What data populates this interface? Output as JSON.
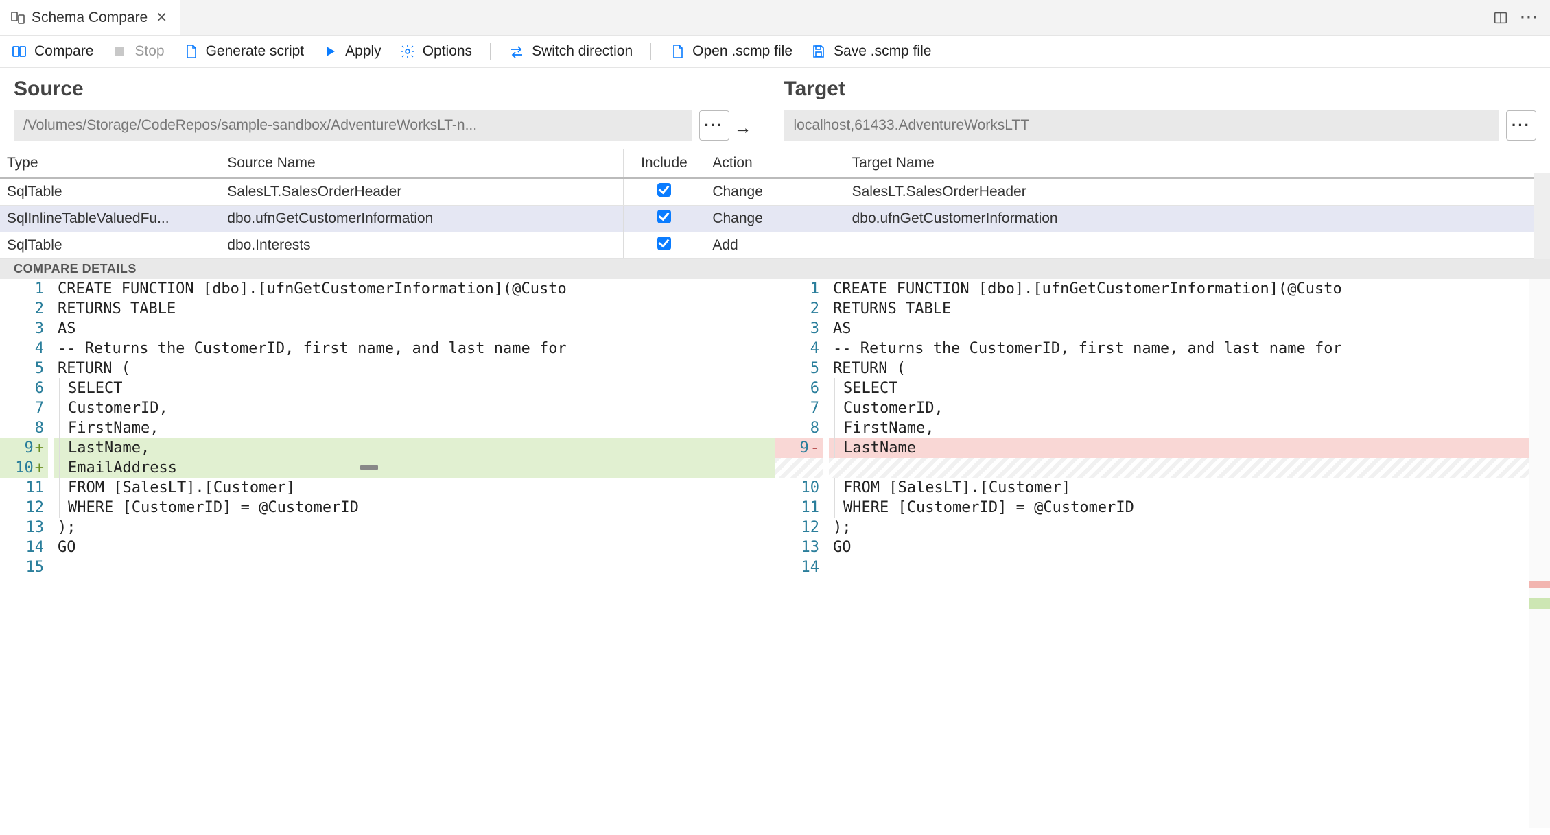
{
  "tab": {
    "title": "Schema Compare"
  },
  "toolbar": {
    "compare": "Compare",
    "stop": "Stop",
    "generate": "Generate script",
    "apply": "Apply",
    "options": "Options",
    "switch": "Switch direction",
    "open": "Open .scmp file",
    "save": "Save .scmp file"
  },
  "labels": {
    "source": "Source",
    "target": "Target",
    "compare_details": "COMPARE DETAILS"
  },
  "source_path": "/Volumes/Storage/CodeRepos/sample-sandbox/AdventureWorksLT-n...",
  "target_path": "localhost,61433.AdventureWorksLTT",
  "columns": {
    "type": "Type",
    "source": "Source Name",
    "include": "Include",
    "action": "Action",
    "target": "Target Name"
  },
  "rows": [
    {
      "type": "SqlTable",
      "src": "SalesLT.SalesOrderHeader",
      "inc": true,
      "act": "Change",
      "tgt": "SalesLT.SalesOrderHeader",
      "selected": false
    },
    {
      "type": "SqlInlineTableValuedFu...",
      "src": "dbo.ufnGetCustomerInformation",
      "inc": true,
      "act": "Change",
      "tgt": "dbo.ufnGetCustomerInformation",
      "selected": true
    },
    {
      "type": "SqlTable",
      "src": "dbo.Interests",
      "inc": true,
      "act": "Add",
      "tgt": "",
      "selected": false
    }
  ],
  "diff": {
    "left": {
      "lines": [
        {
          "n": "1",
          "mark": "",
          "cls": "",
          "indent": false,
          "text": "CREATE FUNCTION [dbo].[ufnGetCustomerInformation](@Custo"
        },
        {
          "n": "2",
          "mark": "",
          "cls": "",
          "indent": false,
          "text": "RETURNS TABLE"
        },
        {
          "n": "3",
          "mark": "",
          "cls": "",
          "indent": false,
          "text": "AS"
        },
        {
          "n": "4",
          "mark": "",
          "cls": "",
          "indent": false,
          "text": "-- Returns the CustomerID, first name, and last name for"
        },
        {
          "n": "5",
          "mark": "",
          "cls": "",
          "indent": false,
          "text": "RETURN ("
        },
        {
          "n": "6",
          "mark": "",
          "cls": "",
          "indent": true,
          "text": "SELECT"
        },
        {
          "n": "7",
          "mark": "",
          "cls": "",
          "indent": true,
          "text": "CustomerID,"
        },
        {
          "n": "8",
          "mark": "",
          "cls": "",
          "indent": true,
          "text": "FirstName,"
        },
        {
          "n": "9",
          "mark": "+",
          "cls": "row-add",
          "indent": true,
          "text": "LastName,"
        },
        {
          "n": "10",
          "mark": "+",
          "cls": "row-add",
          "indent": true,
          "text": "EmailAddress"
        },
        {
          "n": "11",
          "mark": "",
          "cls": "",
          "indent": true,
          "text": "FROM [SalesLT].[Customer]"
        },
        {
          "n": "12",
          "mark": "",
          "cls": "",
          "indent": true,
          "text": "WHERE [CustomerID] = @CustomerID"
        },
        {
          "n": "13",
          "mark": "",
          "cls": "",
          "indent": false,
          "text": ");"
        },
        {
          "n": "14",
          "mark": "",
          "cls": "",
          "indent": false,
          "text": "GO"
        },
        {
          "n": "15",
          "mark": "",
          "cls": "",
          "indent": false,
          "text": ""
        }
      ]
    },
    "right": {
      "lines": [
        {
          "n": "1",
          "mark": "",
          "cls": "",
          "indent": false,
          "text": "CREATE FUNCTION [dbo].[ufnGetCustomerInformation](@Custo"
        },
        {
          "n": "2",
          "mark": "",
          "cls": "",
          "indent": false,
          "text": "RETURNS TABLE"
        },
        {
          "n": "3",
          "mark": "",
          "cls": "",
          "indent": false,
          "text": "AS"
        },
        {
          "n": "4",
          "mark": "",
          "cls": "",
          "indent": false,
          "text": "-- Returns the CustomerID, first name, and last name for"
        },
        {
          "n": "5",
          "mark": "",
          "cls": "",
          "indent": false,
          "text": "RETURN ("
        },
        {
          "n": "6",
          "mark": "",
          "cls": "",
          "indent": true,
          "text": "SELECT"
        },
        {
          "n": "7",
          "mark": "",
          "cls": "",
          "indent": true,
          "text": "CustomerID,"
        },
        {
          "n": "8",
          "mark": "",
          "cls": "",
          "indent": true,
          "text": "FirstName,"
        },
        {
          "n": "9",
          "mark": "-",
          "cls": "row-del",
          "indent": true,
          "text": "LastName"
        },
        {
          "n": "",
          "mark": "",
          "cls": "row-hatch",
          "indent": false,
          "text": ""
        },
        {
          "n": "10",
          "mark": "",
          "cls": "",
          "indent": true,
          "text": "FROM [SalesLT].[Customer]"
        },
        {
          "n": "11",
          "mark": "",
          "cls": "",
          "indent": true,
          "text": "WHERE [CustomerID] = @CustomerID"
        },
        {
          "n": "12",
          "mark": "",
          "cls": "",
          "indent": false,
          "text": ");"
        },
        {
          "n": "13",
          "mark": "",
          "cls": "",
          "indent": false,
          "text": "GO"
        },
        {
          "n": "14",
          "mark": "",
          "cls": "",
          "indent": false,
          "text": ""
        }
      ]
    }
  }
}
